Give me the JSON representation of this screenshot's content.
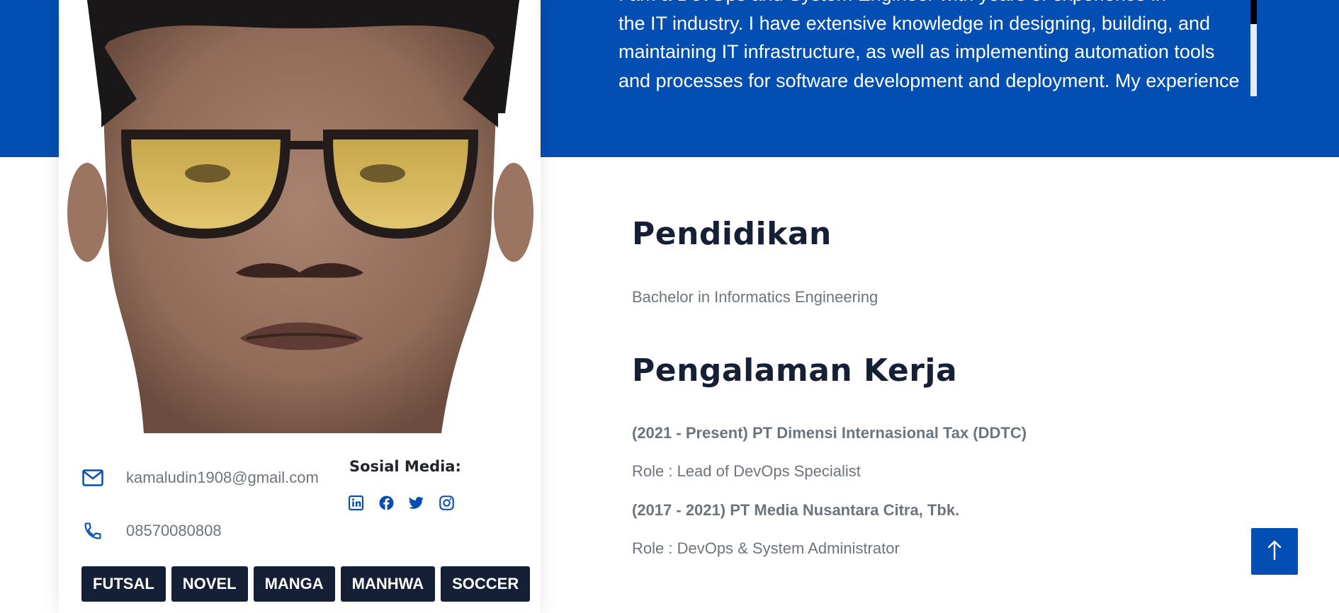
{
  "about": {
    "bio": "I am a DevOps and System Engineer with years of experience in\nthe IT industry. I have extensive knowledge in designing, building, and\nmaintaining IT infrastructure, as well as implementing automation tools\nand processes for software development and deployment. My experience"
  },
  "profile": {
    "email": "kamaludin1908@gmail.com",
    "phone": "08570080808",
    "social_title": "Sosial Media:",
    "social_icons": [
      "linkedin-icon",
      "facebook-icon",
      "twitter-icon",
      "instagram-icon"
    ],
    "tags": [
      "FUTSAL",
      "NOVEL",
      "MANGA",
      "MANHWA",
      "SOCCER"
    ]
  },
  "education": {
    "title": "Pendidikan",
    "degree": "Bachelor in Informatics Engineering"
  },
  "experience": {
    "title": "Pengalaman Kerja",
    "jobs": [
      {
        "period_company": "(2021 - Present) PT Dimensi Internasional Tax (DDTC)",
        "role": "Role : Lead of DevOps Specialist"
      },
      {
        "period_company": "(2017 - 2021) PT Media Nusantara Citra, Tbk.",
        "role": "Role : DevOps & System Administrator"
      }
    ]
  },
  "colors": {
    "primary": "#034eb2",
    "dark": "#152036",
    "muted": "#6c757d"
  }
}
